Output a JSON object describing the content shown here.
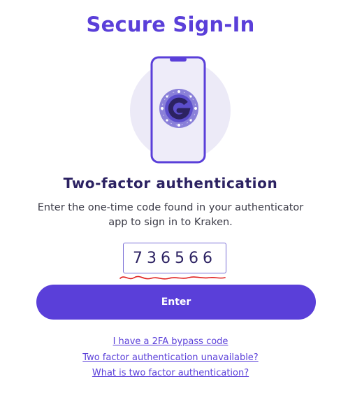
{
  "header": {
    "title": "Secure Sign-In"
  },
  "illustration": {
    "icon": "phone-authenticator-icon"
  },
  "twofa": {
    "subtitle": "Two-factor authentication",
    "description": "Enter the one-time code found in your authenticator app to sign in to Kraken.",
    "code_value": "736566"
  },
  "actions": {
    "enter_label": "Enter"
  },
  "links": {
    "bypass": "I have a 2FA bypass code",
    "unavailable": "Two factor authentication unavailable?",
    "what_is": "What is two factor authentication?"
  },
  "colors": {
    "accent": "#5a3fd9",
    "heading": "#2c2262",
    "annotation": "#e0201f"
  }
}
